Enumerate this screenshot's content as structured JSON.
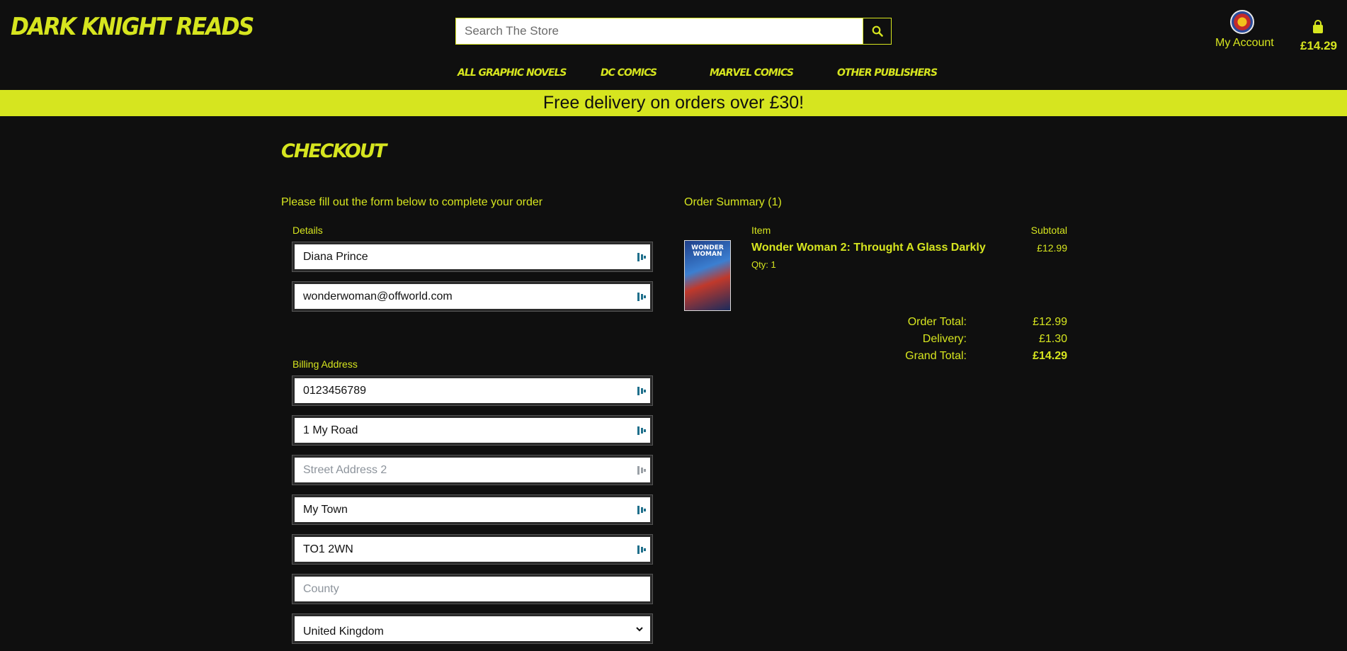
{
  "header": {
    "logo": "DARK KNIGHT READS",
    "search_placeholder": "Search The Store",
    "account_label": "My Account",
    "cart_total": "£14.29",
    "accent_color": "#d6e51f",
    "icons": {
      "search": "search-icon",
      "avatar": "avatar",
      "cart": "shopping-bag-icon"
    }
  },
  "nav": {
    "items": [
      {
        "label": "ALL GRAPHIC NOVELS"
      },
      {
        "label": "DC COMICS"
      },
      {
        "label": "MARVEL COMICS"
      },
      {
        "label": "OTHER PUBLISHERS"
      }
    ]
  },
  "banner": {
    "text": "Free delivery on orders over £30!"
  },
  "checkout": {
    "title": "CHECKOUT",
    "intro": "Please fill out the form below to complete your order",
    "details_label": "Details",
    "full_name": "Diana Prince",
    "email": "wonderwoman@offworld.com",
    "billing_label": "Billing Address",
    "phone": "0123456789",
    "street1": "1 My Road",
    "street2_placeholder": "Street Address 2",
    "town": "My Town",
    "postcode": "TO1 2WN",
    "county_placeholder": "County",
    "country": "United Kingdom"
  },
  "summary": {
    "title": "Order Summary (1)",
    "col_item": "Item",
    "col_subtotal": "Subtotal",
    "items": [
      {
        "name": "Wonder Woman 2: Throught A Glass Darkly",
        "qty": "Qty: 1",
        "subtotal": "£12.99",
        "cover_text": "WONDER WOMAN"
      }
    ],
    "order_total_label": "Order Total:",
    "order_total": "£12.99",
    "delivery_label": "Delivery:",
    "delivery": "£1.30",
    "grand_total_label": "Grand Total:",
    "grand_total": "£14.29"
  }
}
